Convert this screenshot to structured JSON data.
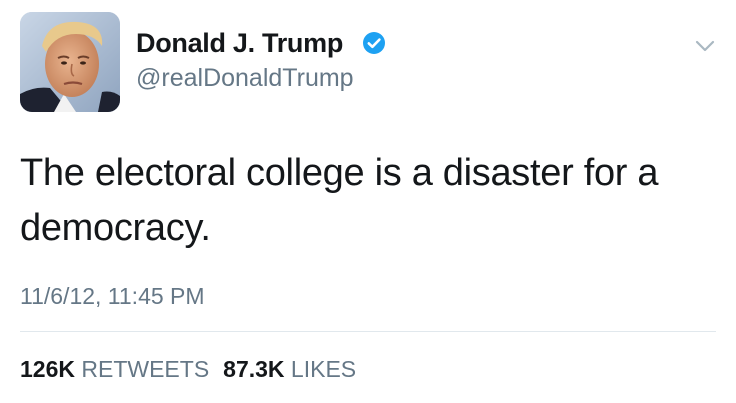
{
  "colors": {
    "verified": "#1da1f2",
    "secondary_text": "#657786",
    "primary_text": "#14171a",
    "divider": "#e1e8ed"
  },
  "author": {
    "display_name": "Donald J. Trump",
    "handle": "@realDonaldTrump",
    "verified_icon": "verified-badge-icon",
    "avatar": "profile-photo"
  },
  "menu_icon": "chevron-down-icon",
  "tweet": {
    "text": "The electoral college is a disaster for a democracy.",
    "timestamp": "11/6/12, 11:45 PM"
  },
  "stats": {
    "retweets_count": "126K",
    "retweets_label": "RETWEETS",
    "likes_count": "87.3K",
    "likes_label": "LIKES"
  }
}
